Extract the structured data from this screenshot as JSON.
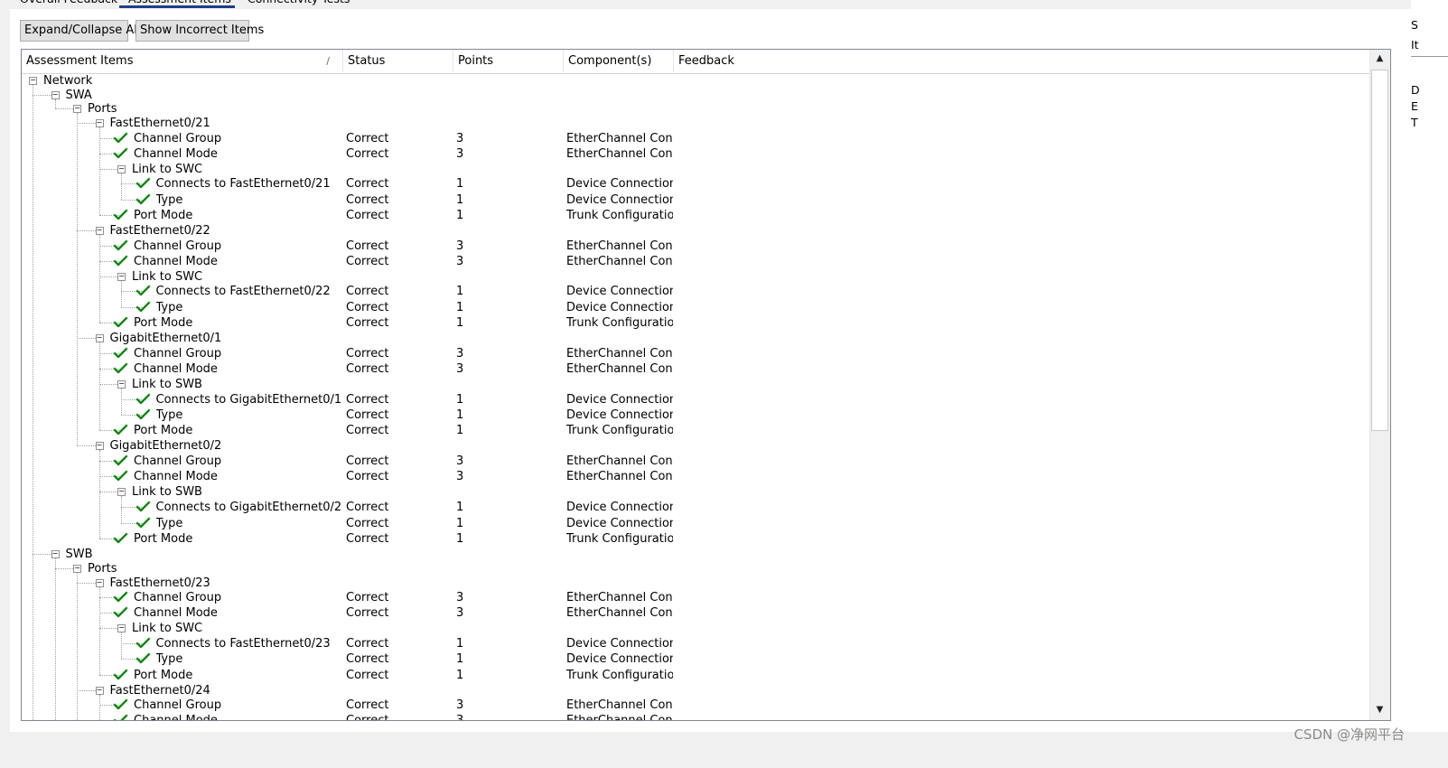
{
  "tabs": [
    {
      "label": "Overall Feedback",
      "active": false
    },
    {
      "label": "Assessment Items",
      "active": true
    },
    {
      "label": "Connectivity Tests",
      "active": false
    }
  ],
  "toolbar": {
    "expand_label": "Expand/Collapse All",
    "incorrect_label": "Show Incorrect Items"
  },
  "columns": [
    "Assessment Items",
    "Status",
    "Points",
    "Component(s)",
    "Feedback"
  ],
  "right_panel": [
    "S",
    "It",
    "D",
    "E",
    "T"
  ],
  "watermark": "CSDN @净网平台",
  "icons": {
    "expand": "collapse-minus-icon",
    "check": "green-check-icon",
    "sort": "sort-indicator-icon"
  },
  "colors": {
    "check": "#22a522",
    "active_tab_underline": "#1f3d8a"
  },
  "rows": [
    {
      "level": 0,
      "label": "Network",
      "type": "node",
      "status": "",
      "points": "",
      "component": ""
    },
    {
      "level": 1,
      "label": "SWA",
      "type": "node",
      "status": "",
      "points": "",
      "component": ""
    },
    {
      "level": 2,
      "label": "Ports",
      "type": "node",
      "status": "",
      "points": "",
      "component": ""
    },
    {
      "level": 3,
      "label": "FastEthernet0/21",
      "type": "node",
      "status": "",
      "points": "",
      "component": ""
    },
    {
      "level": 4,
      "label": "Channel Group",
      "type": "leaf",
      "status": "Correct",
      "points": "3",
      "component": "EtherChannel Con..."
    },
    {
      "level": 4,
      "label": "Channel Mode",
      "type": "leaf",
      "status": "Correct",
      "points": "3",
      "component": "EtherChannel Con..."
    },
    {
      "level": 4,
      "label": "Link to SWC",
      "type": "node",
      "status": "",
      "points": "",
      "component": ""
    },
    {
      "level": 5,
      "label": "Connects to FastEthernet0/21",
      "type": "leaf",
      "status": "Correct",
      "points": "1",
      "component": "Device Connections"
    },
    {
      "level": 5,
      "label": "Type",
      "type": "leaf",
      "status": "Correct",
      "points": "1",
      "component": "Device Connections"
    },
    {
      "level": 4,
      "label": "Port Mode",
      "type": "leaf",
      "status": "Correct",
      "points": "1",
      "component": "Trunk Configuration"
    },
    {
      "level": 3,
      "label": "FastEthernet0/22",
      "type": "node",
      "status": "",
      "points": "",
      "component": ""
    },
    {
      "level": 4,
      "label": "Channel Group",
      "type": "leaf",
      "status": "Correct",
      "points": "3",
      "component": "EtherChannel Con..."
    },
    {
      "level": 4,
      "label": "Channel Mode",
      "type": "leaf",
      "status": "Correct",
      "points": "3",
      "component": "EtherChannel Con..."
    },
    {
      "level": 4,
      "label": "Link to SWC",
      "type": "node",
      "status": "",
      "points": "",
      "component": ""
    },
    {
      "level": 5,
      "label": "Connects to FastEthernet0/22",
      "type": "leaf",
      "status": "Correct",
      "points": "1",
      "component": "Device Connections"
    },
    {
      "level": 5,
      "label": "Type",
      "type": "leaf",
      "status": "Correct",
      "points": "1",
      "component": "Device Connections"
    },
    {
      "level": 4,
      "label": "Port Mode",
      "type": "leaf",
      "status": "Correct",
      "points": "1",
      "component": "Trunk Configuration"
    },
    {
      "level": 3,
      "label": "GigabitEthernet0/1",
      "type": "node",
      "status": "",
      "points": "",
      "component": ""
    },
    {
      "level": 4,
      "label": "Channel Group",
      "type": "leaf",
      "status": "Correct",
      "points": "3",
      "component": "EtherChannel Con..."
    },
    {
      "level": 4,
      "label": "Channel Mode",
      "type": "leaf",
      "status": "Correct",
      "points": "3",
      "component": "EtherChannel Con..."
    },
    {
      "level": 4,
      "label": "Link to SWB",
      "type": "node",
      "status": "",
      "points": "",
      "component": ""
    },
    {
      "level": 5,
      "label": "Connects to GigabitEthernet0/1",
      "type": "leaf",
      "status": "Correct",
      "points": "1",
      "component": "Device Connections"
    },
    {
      "level": 5,
      "label": "Type",
      "type": "leaf",
      "status": "Correct",
      "points": "1",
      "component": "Device Connections"
    },
    {
      "level": 4,
      "label": "Port Mode",
      "type": "leaf",
      "status": "Correct",
      "points": "1",
      "component": "Trunk Configuration"
    },
    {
      "level": 3,
      "label": "GigabitEthernet0/2",
      "type": "node",
      "status": "",
      "points": "",
      "component": ""
    },
    {
      "level": 4,
      "label": "Channel Group",
      "type": "leaf",
      "status": "Correct",
      "points": "3",
      "component": "EtherChannel Con..."
    },
    {
      "level": 4,
      "label": "Channel Mode",
      "type": "leaf",
      "status": "Correct",
      "points": "3",
      "component": "EtherChannel Con..."
    },
    {
      "level": 4,
      "label": "Link to SWB",
      "type": "node",
      "status": "",
      "points": "",
      "component": ""
    },
    {
      "level": 5,
      "label": "Connects to GigabitEthernet0/2",
      "type": "leaf",
      "status": "Correct",
      "points": "1",
      "component": "Device Connections"
    },
    {
      "level": 5,
      "label": "Type",
      "type": "leaf",
      "status": "Correct",
      "points": "1",
      "component": "Device Connections"
    },
    {
      "level": 4,
      "label": "Port Mode",
      "type": "leaf",
      "status": "Correct",
      "points": "1",
      "component": "Trunk Configuration"
    },
    {
      "level": 1,
      "label": "SWB",
      "type": "node",
      "status": "",
      "points": "",
      "component": ""
    },
    {
      "level": 2,
      "label": "Ports",
      "type": "node",
      "status": "",
      "points": "",
      "component": ""
    },
    {
      "level": 3,
      "label": "FastEthernet0/23",
      "type": "node",
      "status": "",
      "points": "",
      "component": ""
    },
    {
      "level": 4,
      "label": "Channel Group",
      "type": "leaf",
      "status": "Correct",
      "points": "3",
      "component": "EtherChannel Con..."
    },
    {
      "level": 4,
      "label": "Channel Mode",
      "type": "leaf",
      "status": "Correct",
      "points": "3",
      "component": "EtherChannel Con..."
    },
    {
      "level": 4,
      "label": "Link to SWC",
      "type": "node",
      "status": "",
      "points": "",
      "component": ""
    },
    {
      "level": 5,
      "label": "Connects to FastEthernet0/23",
      "type": "leaf",
      "status": "Correct",
      "points": "1",
      "component": "Device Connections"
    },
    {
      "level": 5,
      "label": "Type",
      "type": "leaf",
      "status": "Correct",
      "points": "1",
      "component": "Device Connections"
    },
    {
      "level": 4,
      "label": "Port Mode",
      "type": "leaf",
      "status": "Correct",
      "points": "1",
      "component": "Trunk Configuration"
    },
    {
      "level": 3,
      "label": "FastEthernet0/24",
      "type": "node",
      "status": "",
      "points": "",
      "component": ""
    },
    {
      "level": 4,
      "label": "Channel Group",
      "type": "leaf",
      "status": "Correct",
      "points": "3",
      "component": "EtherChannel Con..."
    },
    {
      "level": 4,
      "label": "Channel Mode",
      "type": "leaf",
      "status": "Correct",
      "points": "3",
      "component": "EtherChannel Con..."
    }
  ]
}
